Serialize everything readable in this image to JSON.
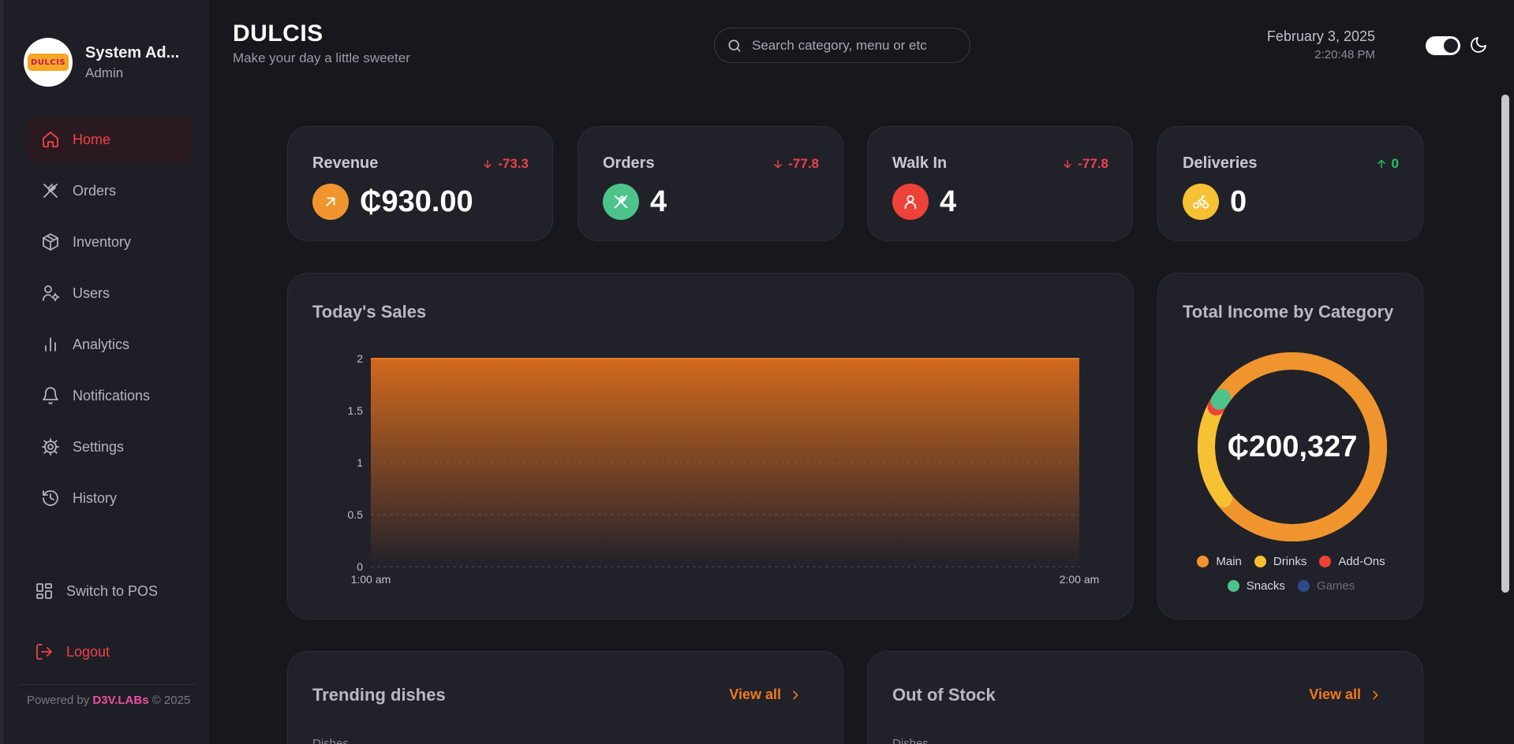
{
  "profile": {
    "name": "System Ad...",
    "role": "Admin",
    "logo_text": "DULCIS"
  },
  "nav": [
    {
      "label": "Home",
      "icon": "home-icon",
      "active": true
    },
    {
      "label": "Orders",
      "icon": "utensils-icon",
      "active": false
    },
    {
      "label": "Inventory",
      "icon": "box-icon",
      "active": false
    },
    {
      "label": "Users",
      "icon": "user-cog-icon",
      "active": false
    },
    {
      "label": "Analytics",
      "icon": "bar-chart-icon",
      "active": false
    },
    {
      "label": "Notifications",
      "icon": "bell-icon",
      "active": false
    },
    {
      "label": "Settings",
      "icon": "gear-icon",
      "active": false
    },
    {
      "label": "History",
      "icon": "history-icon",
      "active": false
    }
  ],
  "switch_pos": "Switch to POS",
  "logout": "Logout",
  "footer": {
    "prefix": "Powered by ",
    "brand": "D3V.LABs",
    "suffix": " © 2025"
  },
  "header": {
    "title": "DULCIS",
    "subtitle": "Make your day a little sweeter",
    "search_placeholder": "Search category, menu or etc",
    "date": "February 3, 2025",
    "time": "2:20:48 PM"
  },
  "stats": [
    {
      "label": "Revenue",
      "change": "-73.3",
      "direction": "down",
      "value": "₵930.00",
      "icon": "arrow-up-right-icon",
      "color": "#f0952e"
    },
    {
      "label": "Orders",
      "change": "-77.8",
      "direction": "down",
      "value": "4",
      "icon": "utensils-icon",
      "color": "#4cc38a"
    },
    {
      "label": "Walk In",
      "change": "-77.8",
      "direction": "down",
      "value": "4",
      "icon": "user-icon",
      "color": "#ee4238"
    },
    {
      "label": "Deliveries",
      "change": "0",
      "direction": "up",
      "value": "0",
      "icon": "bike-icon",
      "color": "#f7c134"
    }
  ],
  "colors": {
    "down": "#f0424a",
    "up": "#22c55e",
    "accent": "#f07a1a"
  },
  "sales_card": {
    "title": "Today's Sales"
  },
  "chart_data": {
    "type": "area",
    "title": "Today's Sales",
    "x": [
      "1:00 am",
      "2:00 am"
    ],
    "values": [
      2,
      2
    ],
    "ylim": [
      0,
      2
    ],
    "yticks": [
      "0",
      "0.5",
      "1",
      "1.5",
      "2"
    ],
    "grid": true,
    "color": "#d2691e"
  },
  "income_card": {
    "title": "Total Income by Category",
    "total": "₵200,327",
    "segments": [
      {
        "name": "Main",
        "color": "#f0952e",
        "share": 0.8
      },
      {
        "name": "Drinks",
        "color": "#f7c134",
        "share": 0.18
      },
      {
        "name": "Add-Ons",
        "color": "#ee4238",
        "share": 0.012
      },
      {
        "name": "Snacks",
        "color": "#4cc38a",
        "share": 0.008
      },
      {
        "name": "Games",
        "color": "#2d4a8a",
        "share": 0.0
      }
    ]
  },
  "trending": {
    "title": "Trending dishes",
    "view_all": "View all",
    "col_head": "Dishes"
  },
  "out_of_stock": {
    "title": "Out of Stock",
    "view_all": "View all",
    "col_head": "Dishes"
  }
}
